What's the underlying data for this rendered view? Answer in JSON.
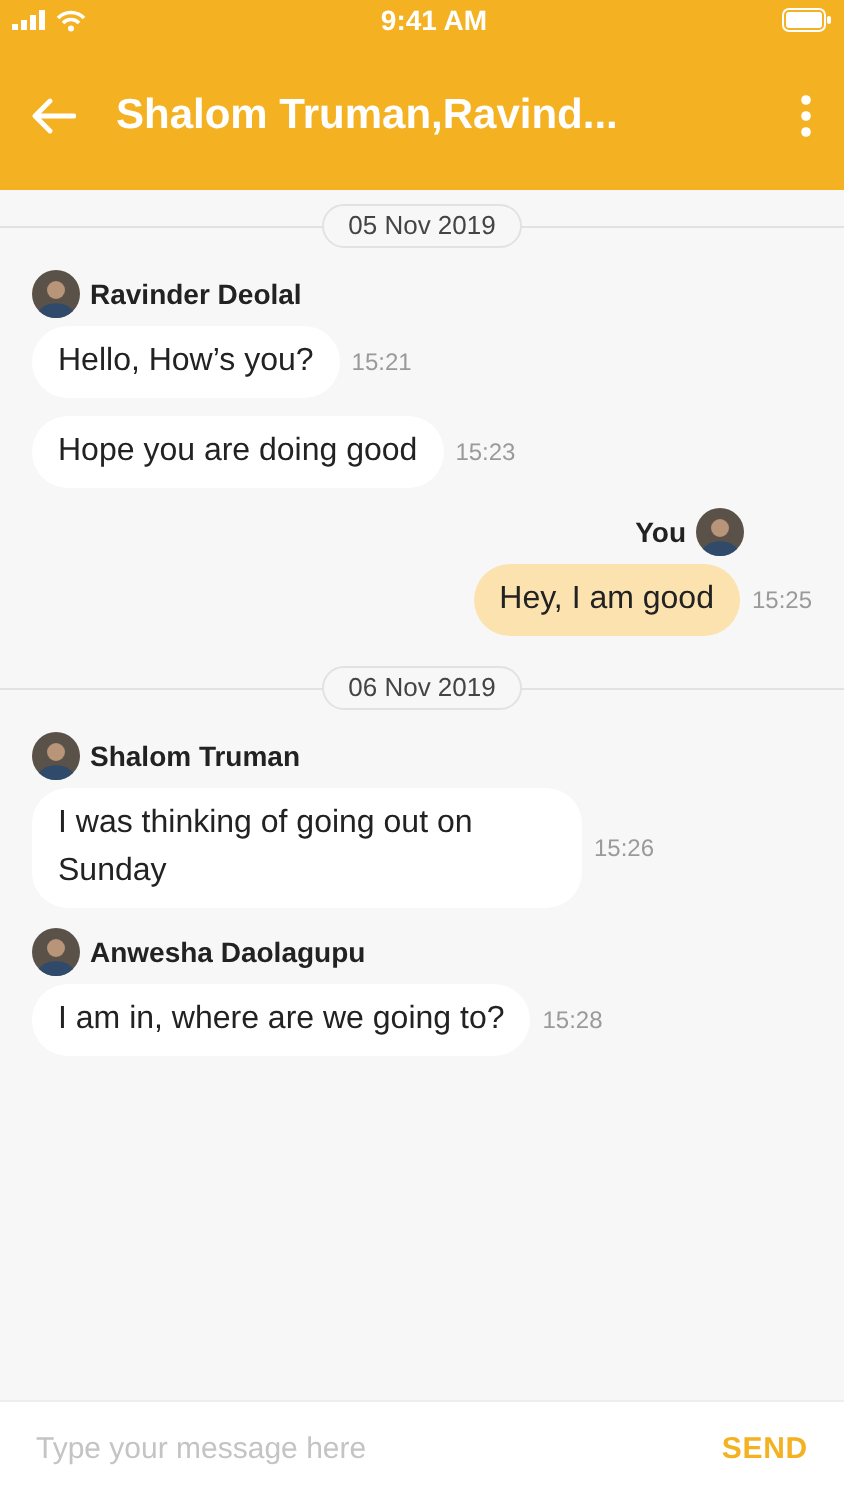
{
  "status_bar": {
    "time": "9:41 AM"
  },
  "header": {
    "title": "Shalom Truman,Ravind..."
  },
  "groups": [
    {
      "date": "05 Nov 2019",
      "messages": [
        {
          "kind": "incoming",
          "sender": "Ravinder Deolal",
          "text": "Hello, How’s you?",
          "time": "15:21"
        },
        {
          "kind": "incoming",
          "text": "Hope you are doing good",
          "time": "15:23"
        },
        {
          "kind": "outgoing",
          "sender": "You",
          "text": "Hey, I am good",
          "time": "15:25"
        }
      ]
    },
    {
      "date": "06 Nov 2019",
      "messages": [
        {
          "kind": "incoming",
          "sender": "Shalom Truman",
          "text": "I was thinking of going out on Sunday",
          "time": "15:26"
        },
        {
          "kind": "incoming",
          "sender": "Anwesha Daolagupu",
          "text": "I am in, where are we going to?",
          "time": "15:28"
        }
      ]
    }
  ],
  "composer": {
    "placeholder": "Type your message here",
    "send": "SEND"
  }
}
